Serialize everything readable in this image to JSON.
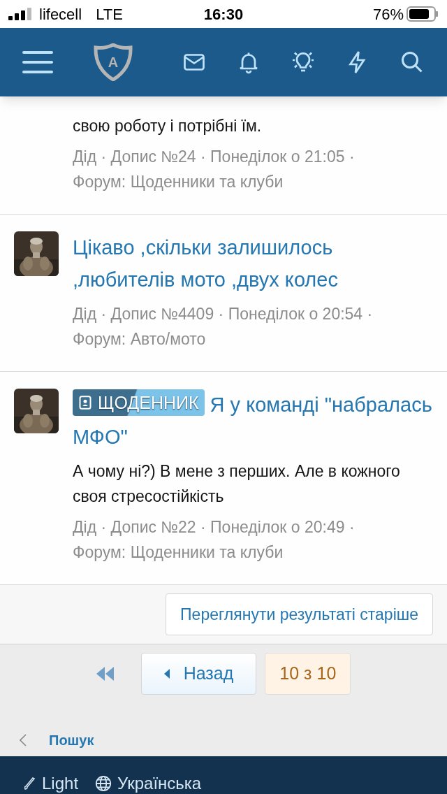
{
  "status_bar": {
    "carrier": "lifecell",
    "network": "LTE",
    "time": "16:30",
    "battery": "76%"
  },
  "header": {
    "logo_letter": "A"
  },
  "results": [
    {
      "snippet": "свою роботу і потрібні їм.",
      "meta": "Дід · Допис №24 · Понеділок о 21:05 ·",
      "forum": "Форум: Щоденники та клуби"
    },
    {
      "title": "Цікаво ,скільки залишилось ,любителів мото ,двух колес",
      "meta": "Дід · Допис №4409 · Понеділок о 20:54 ·",
      "forum": "Форум: Авто/мото"
    },
    {
      "label": "ЩОДЕННИК",
      "title": "Я у команді \"набралась МФО\"",
      "snippet": "А чому ні?) В мене з перших. Але в кожного своя стресостійкість",
      "meta": "Дід · Допис №22 · Понеділок о 20:49 ·",
      "forum": "Форум: Щоденники та клуби"
    }
  ],
  "older_button": "Переглянути результаті старіше",
  "pagination": {
    "prev": "Назад",
    "current": "10 з 10"
  },
  "breadcrumb": "Пошук",
  "footer": {
    "style_link": "Light",
    "language_link": "Українська"
  }
}
